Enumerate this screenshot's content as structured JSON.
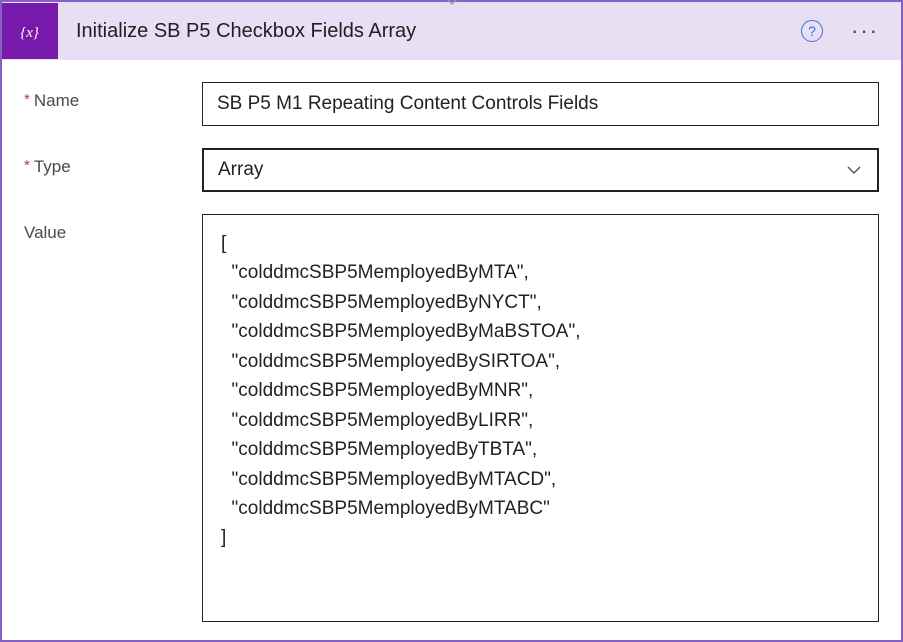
{
  "header": {
    "title": "Initialize SB P5 Checkbox Fields Array"
  },
  "fields": {
    "name": {
      "label": "Name",
      "value": "SB P5 M1 Repeating Content Controls Fields"
    },
    "type": {
      "label": "Type",
      "value": "Array"
    },
    "value": {
      "label": "Value",
      "text": "[\n  \"colddmcSBP5MemployedByMTA\",\n  \"colddmcSBP5MemployedByNYCT\",\n  \"colddmcSBP5MemployedByMaBSTOA\",\n  \"colddmcSBP5MemployedBySIRTOA\",\n  \"colddmcSBP5MemployedByMNR\",\n  \"colddmcSBP5MemployedByLIRR\",\n  \"colddmcSBP5MemployedByTBTA\",\n  \"colddmcSBP5MemployedByMTACD\",\n  \"colddmcSBP5MemployedByMTABC\"\n]"
    }
  }
}
